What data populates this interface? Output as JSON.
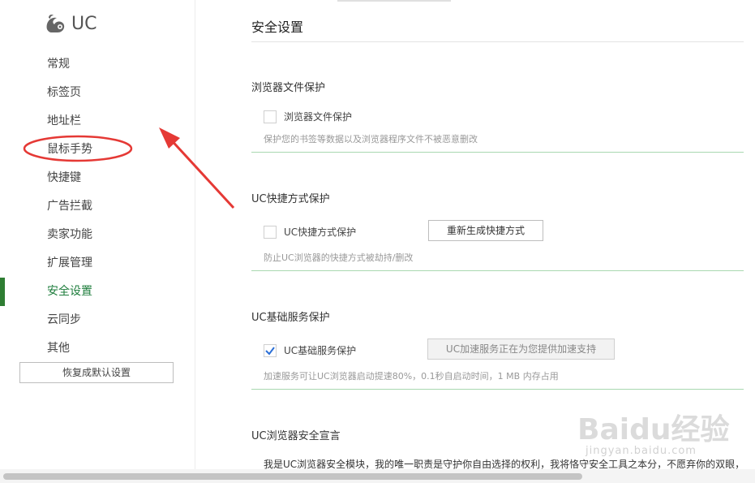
{
  "app": {
    "logo_text": "UC"
  },
  "sidebar": {
    "items": [
      {
        "label": "常规"
      },
      {
        "label": "标签页"
      },
      {
        "label": "地址栏"
      },
      {
        "label": "鼠标手势"
      },
      {
        "label": "快捷键"
      },
      {
        "label": "广告拦截"
      },
      {
        "label": "卖家功能"
      },
      {
        "label": "扩展管理"
      },
      {
        "label": "安全设置",
        "active": true
      },
      {
        "label": "云同步"
      },
      {
        "label": "其他"
      }
    ],
    "reset_label": "恢复成默认设置"
  },
  "main": {
    "title": "安全设置",
    "sections": {
      "file_protect": {
        "title": "浏览器文件保护",
        "checkbox_label": "浏览器文件保护",
        "checked": false,
        "desc": "保护您的书签等数据以及浏览器程序文件不被恶意删改"
      },
      "shortcut_protect": {
        "title": "UC快捷方式保护",
        "checkbox_label": "UC快捷方式保护",
        "checked": false,
        "button_label": "重新生成快捷方式",
        "desc": "防止UC浏览器的快捷方式被劫持/删改"
      },
      "base_service": {
        "title": "UC基础服务保护",
        "checkbox_label": "UC基础服务保护",
        "checked": true,
        "button_label": "UC加速服务正在为您提供加速支持",
        "desc": "加速服务可让UC浏览器启动提速80%，0.1秒自启动时间，1 MB 内存占用"
      },
      "declaration": {
        "title": "UC浏览器安全宣言",
        "text": "我是UC浏览器安全模块，我的唯一职责是守护你自由选择的权利，我将恪守安全工具之本分，不愿弃你的双眼，"
      }
    }
  },
  "watermark": {
    "main": "Baidu经验",
    "sub": "jingyan.baidu.com"
  },
  "colors": {
    "accent": "#2e7d32",
    "annotation": "#e53935",
    "rule": "#a9d8b0"
  }
}
